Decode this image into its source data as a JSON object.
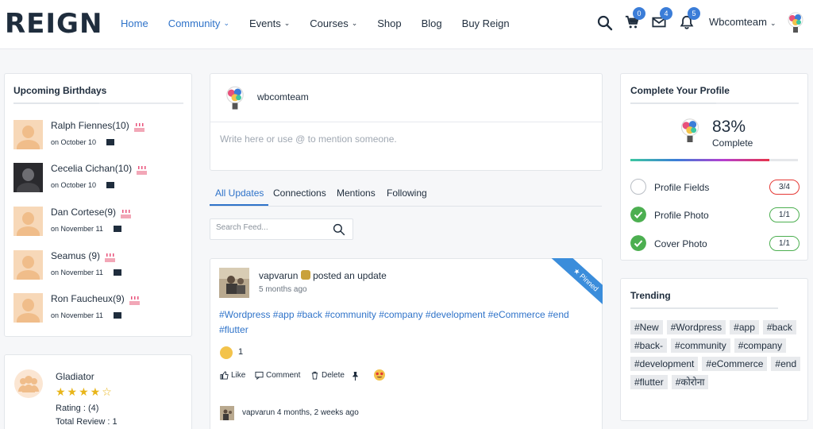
{
  "header": {
    "logo": "REIGN",
    "nav": [
      {
        "label": "Home"
      },
      {
        "label": "Community"
      },
      {
        "label": "Events"
      },
      {
        "label": "Courses"
      },
      {
        "label": "Shop"
      },
      {
        "label": "Blog"
      },
      {
        "label": "Buy Reign"
      }
    ],
    "badges": {
      "cart": "0",
      "messages": "4",
      "notifications": "5"
    },
    "username": "Wbcomteam"
  },
  "birthdays": {
    "title": "Upcoming Birthdays",
    "items": [
      {
        "name": "Ralph Fiennes",
        "age": "(10)",
        "date": "on October 10"
      },
      {
        "name": "Cecelia Cichan",
        "age": "(10)",
        "date": "on October 10"
      },
      {
        "name": "Dan Cortese",
        "age": "(9)",
        "date": "on November 11"
      },
      {
        "name": "Seamus",
        "age": " (9)",
        "date": "on November 11"
      },
      {
        "name": "Ron Faucheux",
        "age": "(9)",
        "date": "on November 11"
      }
    ]
  },
  "gladiator": {
    "name": "Gladiator",
    "stars": "★★★★☆",
    "rating": "Rating : (4)",
    "total": "Total Review : 1"
  },
  "composer": {
    "name": "wbcomteam",
    "placeholder": "Write here or use @ to mention someone."
  },
  "tabs": [
    "All Updates",
    "Connections",
    "Mentions",
    "Following"
  ],
  "search": {
    "placeholder": "Search Feed..."
  },
  "post": {
    "user": "vapvarun",
    "action": "posted an update",
    "time": "5 months ago",
    "pinned": "Pinned",
    "tags": "#Wordpress #app #back #community #company #development #eCommerce #end #flutter",
    "reaction_count": "1",
    "like": "Like",
    "comment": "Comment",
    "delete": "Delete",
    "comment_user": "vapvarun",
    "comment_time": "4 months, 2 weeks ago"
  },
  "profile": {
    "title": "Complete Your Profile",
    "percent": "83%",
    "percent_value": 83,
    "complete": "Complete",
    "rows": [
      {
        "label": "Profile Fields",
        "value": "3/4",
        "done": false
      },
      {
        "label": "Profile Photo",
        "value": "1/1",
        "done": true
      },
      {
        "label": "Cover Photo",
        "value": "1/1",
        "done": true
      }
    ]
  },
  "trending": {
    "title": "Trending",
    "tags": [
      "#New",
      "#Wordpress",
      "#app",
      "#back",
      "#back-",
      "#community",
      "#company",
      "#development",
      "#eCommerce",
      "#end",
      "#flutter",
      "#कोरोना"
    ]
  },
  "colors": {
    "accent": "#2f73c9",
    "success": "#4caf50",
    "danger": "#e53935",
    "star": "#e8b51a"
  }
}
